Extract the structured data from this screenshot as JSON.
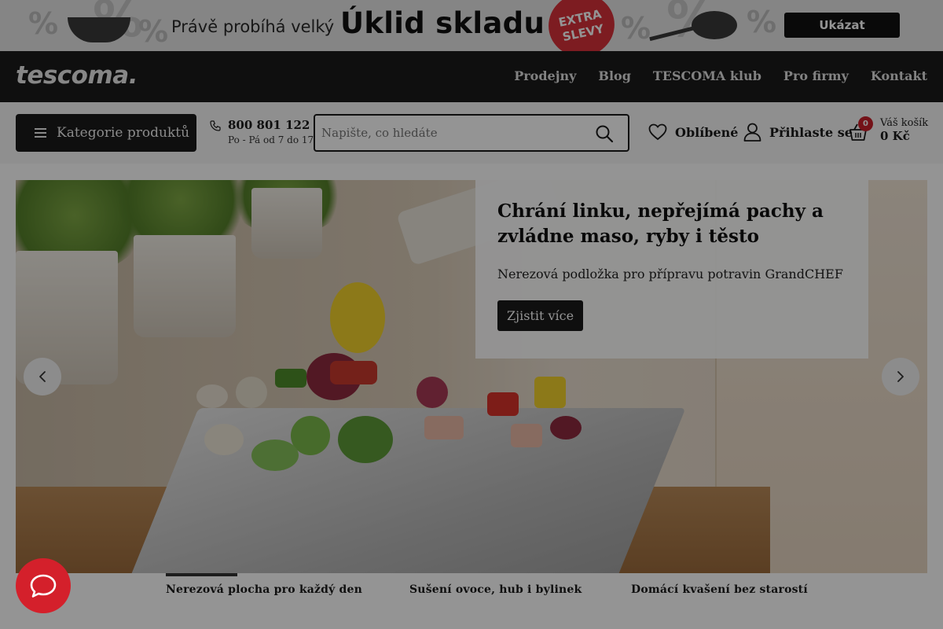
{
  "promo": {
    "percent_sign": "%",
    "text": "Právě probíhá velký",
    "title": "Úklid skladu",
    "badge_line1": "EXTRA",
    "badge_line2": "SLEVY",
    "button": "Ukázat"
  },
  "header": {
    "logo": "tescoma.",
    "nav": [
      "Prodejny",
      "Blog",
      "TESCOMA klub",
      "Pro firmy",
      "Kontakt"
    ]
  },
  "utility": {
    "categories_label": "Kategorie produktů",
    "phone_number": "800 801 122",
    "phone_hours": "Po - Pá od 7 do 17",
    "search_placeholder": "Napište, co hledáte",
    "favorites_label": "Oblíbené",
    "login_label": "Přihlaste se",
    "cart_count": "0",
    "cart_label": "Váš košík",
    "cart_amount": "0 Kč"
  },
  "hero": {
    "heading": "Chrání linku, nepřejímá pachy a zvládne maso, ryby i těsto",
    "subheading": "Nerezová podložka pro přípravu potravin GrandCHEF",
    "cta": "Zjistit více"
  },
  "slides": {
    "active_index": 0,
    "tabs": [
      "Nerezová plocha pro každý den",
      "Sušení ovoce, hub i bylinek",
      "Domácí kvašení bez starostí"
    ]
  },
  "colors": {
    "brand_dark": "#1a1a1a",
    "accent_red": "#d4202b",
    "promo_bg": "#e6e6e6"
  },
  "icons": {
    "menu": "hamburger-icon",
    "phone": "phone-icon",
    "search": "search-icon",
    "favorites": "heart-icon",
    "login": "user-icon",
    "cart": "basket-icon",
    "prev": "chevron-left-icon",
    "next": "chevron-right-icon",
    "chat": "chat-bubble-icon"
  }
}
